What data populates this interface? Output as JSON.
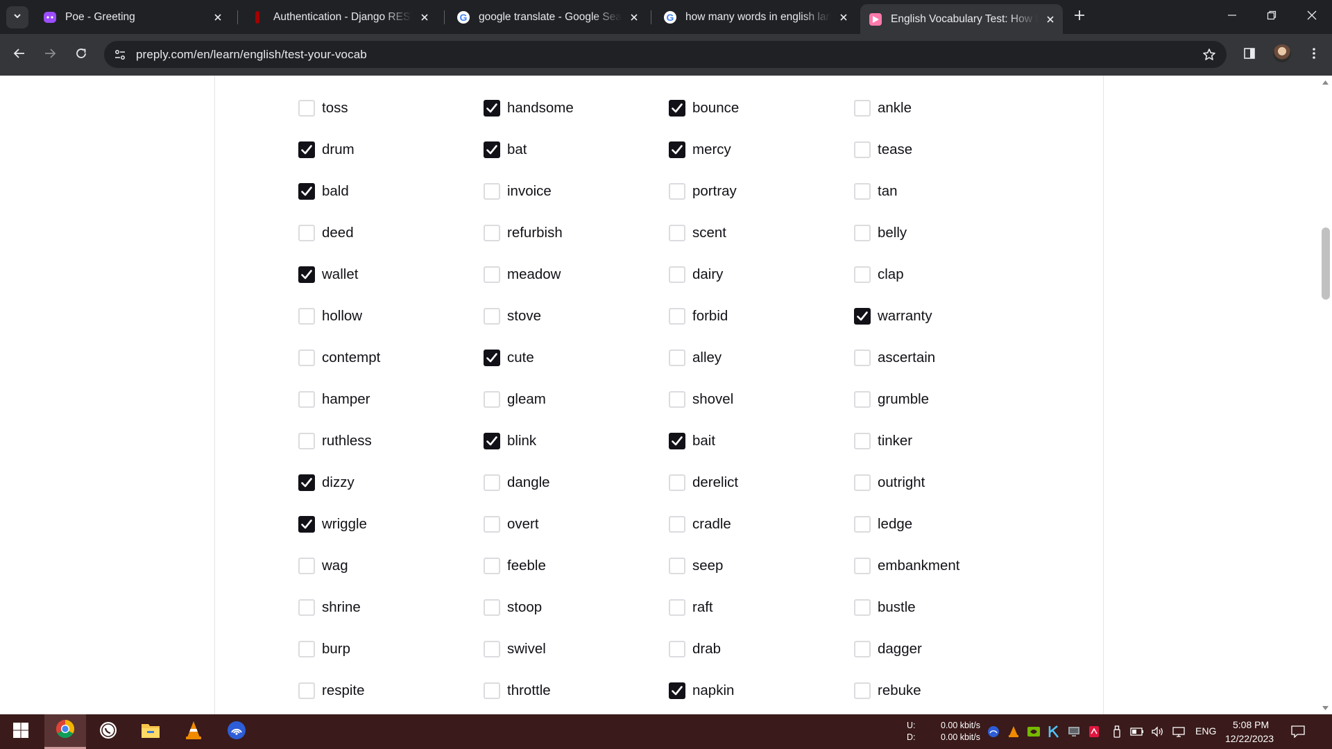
{
  "browser": {
    "tabs": [
      {
        "title": "Poe - Greeting",
        "icon": "poe-icon",
        "active": false
      },
      {
        "title": "Authentication - Django REST framework",
        "icon": "django-rest-icon",
        "active": false
      },
      {
        "title": "google translate - Google Search",
        "icon": "google-icon",
        "active": false
      },
      {
        "title": "how many words in english language",
        "icon": "google-icon",
        "active": false
      },
      {
        "title": "English Vocabulary Test: How Many Words Do You Know?",
        "icon": "preply-icon",
        "active": true
      }
    ],
    "url": "preply.com/en/learn/english/test-your-vocab"
  },
  "vocab_test": {
    "columns": [
      [
        {
          "word": "toss",
          "checked": false
        },
        {
          "word": "drum",
          "checked": true
        },
        {
          "word": "bald",
          "checked": true
        },
        {
          "word": "deed",
          "checked": false
        },
        {
          "word": "wallet",
          "checked": true
        },
        {
          "word": "hollow",
          "checked": false
        },
        {
          "word": "contempt",
          "checked": false
        },
        {
          "word": "hamper",
          "checked": false
        },
        {
          "word": "ruthless",
          "checked": false
        },
        {
          "word": "dizzy",
          "checked": true
        },
        {
          "word": "wriggle",
          "checked": true
        },
        {
          "word": "wag",
          "checked": false
        },
        {
          "word": "shrine",
          "checked": false
        },
        {
          "word": "burp",
          "checked": false
        },
        {
          "word": "respite",
          "checked": false
        }
      ],
      [
        {
          "word": "handsome",
          "checked": true
        },
        {
          "word": "bat",
          "checked": true
        },
        {
          "word": "invoice",
          "checked": false
        },
        {
          "word": "refurbish",
          "checked": false
        },
        {
          "word": "meadow",
          "checked": false
        },
        {
          "word": "stove",
          "checked": false
        },
        {
          "word": "cute",
          "checked": true
        },
        {
          "word": "gleam",
          "checked": false
        },
        {
          "word": "blink",
          "checked": true
        },
        {
          "word": "dangle",
          "checked": false
        },
        {
          "word": "overt",
          "checked": false
        },
        {
          "word": "feeble",
          "checked": false
        },
        {
          "word": "stoop",
          "checked": false
        },
        {
          "word": "swivel",
          "checked": false
        },
        {
          "word": "throttle",
          "checked": false
        }
      ],
      [
        {
          "word": "bounce",
          "checked": true
        },
        {
          "word": "mercy",
          "checked": true
        },
        {
          "word": "portray",
          "checked": false
        },
        {
          "word": "scent",
          "checked": false
        },
        {
          "word": "dairy",
          "checked": false
        },
        {
          "word": "forbid",
          "checked": false
        },
        {
          "word": "alley",
          "checked": false
        },
        {
          "word": "shovel",
          "checked": false
        },
        {
          "word": "bait",
          "checked": true
        },
        {
          "word": "derelict",
          "checked": false
        },
        {
          "word": "cradle",
          "checked": false
        },
        {
          "word": "seep",
          "checked": false
        },
        {
          "word": "raft",
          "checked": false
        },
        {
          "word": "drab",
          "checked": false
        },
        {
          "word": "napkin",
          "checked": true
        }
      ],
      [
        {
          "word": "ankle",
          "checked": false
        },
        {
          "word": "tease",
          "checked": false
        },
        {
          "word": "tan",
          "checked": false
        },
        {
          "word": "belly",
          "checked": false
        },
        {
          "word": "clap",
          "checked": false
        },
        {
          "word": "warranty",
          "checked": true
        },
        {
          "word": "ascertain",
          "checked": false
        },
        {
          "word": "grumble",
          "checked": false
        },
        {
          "word": "tinker",
          "checked": false
        },
        {
          "word": "outright",
          "checked": false
        },
        {
          "word": "ledge",
          "checked": false
        },
        {
          "word": "embankment",
          "checked": false
        },
        {
          "word": "bustle",
          "checked": false
        },
        {
          "word": "dagger",
          "checked": false
        },
        {
          "word": "rebuke",
          "checked": false
        }
      ]
    ]
  },
  "taskbar": {
    "apps": [
      "windows-start-icon",
      "chrome-icon",
      "whatsapp-icon",
      "file-explorer-icon",
      "vlc-icon",
      "network-app-icon"
    ],
    "net_up_label": "U:",
    "net_down_label": "D:",
    "net_up_value": "0.00 kbit/s",
    "net_down_value": "0.00 kbit/s",
    "language": "ENG",
    "time": "5:08 PM",
    "date": "12/22/2023"
  },
  "colors": {
    "chrome_dark": "#202124",
    "chrome_toolbar": "#35363a",
    "checkbox_checked": "#121117",
    "taskbar": "#3a1a1a"
  }
}
